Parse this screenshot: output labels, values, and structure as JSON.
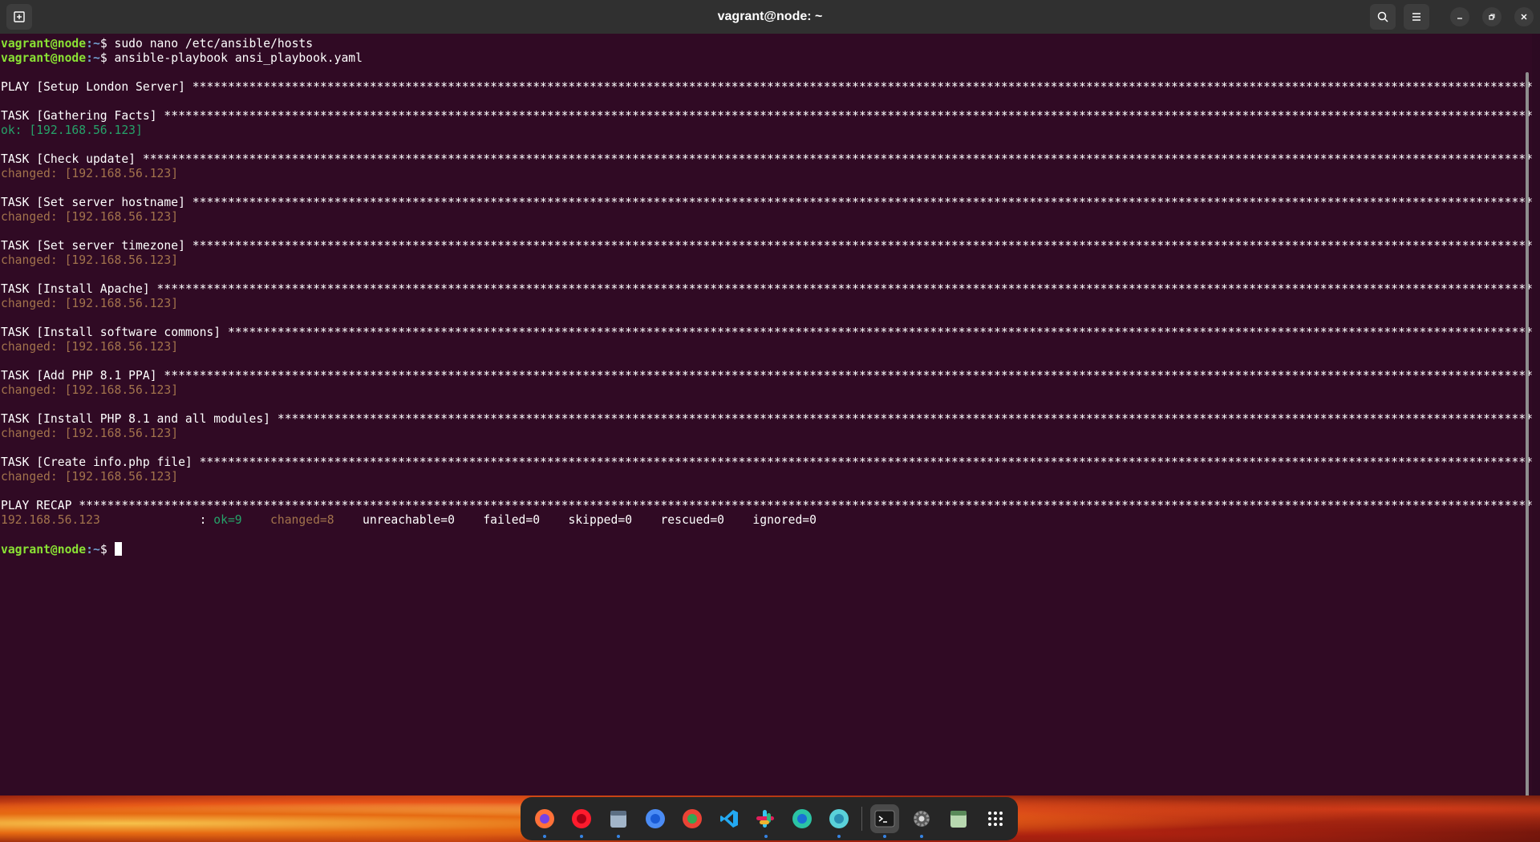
{
  "window": {
    "title": "vagrant@node: ~",
    "new_tab_icon": "new-tab-icon",
    "search_icon": "search-icon",
    "menu_icon": "hamburger-menu-icon",
    "minimize_icon": "minimize-icon",
    "maximize_icon": "restore-icon",
    "close_icon": "close-icon"
  },
  "terminal": {
    "prompt_user": "vagrant@node",
    "prompt_path": ":~",
    "prompt_symbol": "$ ",
    "commands": [
      "sudo nano /etc/ansible/hosts",
      "ansible-playbook ansi_playbook.yaml"
    ],
    "play_header": "PLAY [Setup London Server] ",
    "tasks": [
      {
        "header": "TASK [Gathering Facts] ",
        "status": "ok",
        "result": "ok: [192.168.56.123]"
      },
      {
        "header": "TASK [Check update] ",
        "status": "changed",
        "result": "changed: [192.168.56.123]"
      },
      {
        "header": "TASK [Set server hostname] ",
        "status": "changed",
        "result": "changed: [192.168.56.123]"
      },
      {
        "header": "TASK [Set server timezone] ",
        "status": "changed",
        "result": "changed: [192.168.56.123]"
      },
      {
        "header": "TASK [Install Apache] ",
        "status": "changed",
        "result": "changed: [192.168.56.123]"
      },
      {
        "header": "TASK [Install software commons] ",
        "status": "changed",
        "result": "changed: [192.168.56.123]"
      },
      {
        "header": "TASK [Add PHP 8.1 PPA] ",
        "status": "changed",
        "result": "changed: [192.168.56.123]"
      },
      {
        "header": "TASK [Install PHP 8.1 and all modules] ",
        "status": "changed",
        "result": "changed: [192.168.56.123]"
      },
      {
        "header": "TASK [Create info.php file] ",
        "status": "changed",
        "result": "changed: [192.168.56.123]"
      }
    ],
    "recap_header": "PLAY RECAP ",
    "recap": {
      "host": "192.168.56.123",
      "separator": "              : ",
      "ok": "ok=9",
      "changed": "changed=8",
      "unreachable": "unreachable=0",
      "failed": "failed=0",
      "skipped": "skipped=0",
      "rescued": "rescued=0",
      "ignored": "ignored=0"
    }
  },
  "dock": {
    "items": [
      {
        "name": "firefox-icon",
        "running": true
      },
      {
        "name": "opera-icon",
        "running": true
      },
      {
        "name": "files-icon",
        "running": true
      },
      {
        "name": "chromium-icon",
        "running": false
      },
      {
        "name": "chrome-icon",
        "running": false
      },
      {
        "name": "vscode-icon",
        "running": false
      },
      {
        "name": "slack-icon",
        "running": true
      },
      {
        "name": "edge-icon",
        "running": false
      },
      {
        "name": "mail-icon",
        "running": true
      },
      {
        "name": "terminal-icon",
        "running": true
      },
      {
        "name": "settings-icon",
        "running": true
      },
      {
        "name": "trash-icon",
        "running": false
      },
      {
        "name": "app-grid-icon",
        "running": false
      }
    ]
  },
  "colors": {
    "terminal_bg": "#300a24",
    "prompt_user": "#8ae234",
    "prompt_path": "#729fcf",
    "ok": "#26a269",
    "changed": "#a2734c"
  }
}
